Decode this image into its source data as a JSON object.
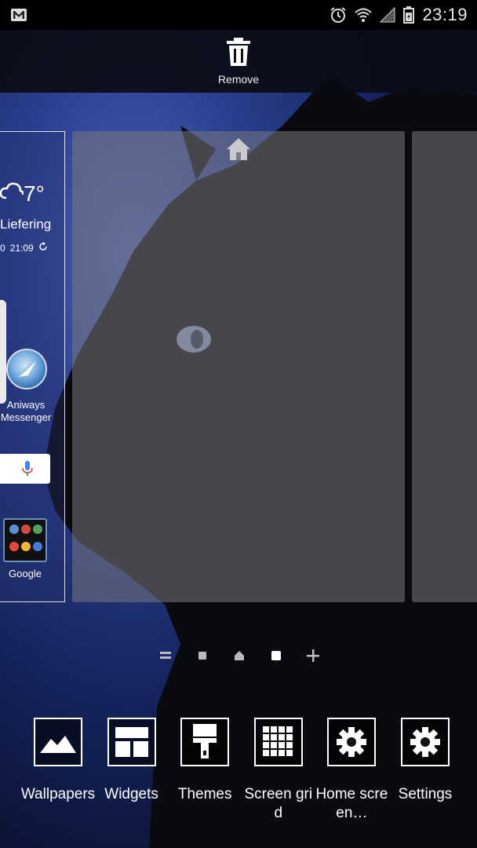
{
  "status_bar": {
    "time": "23:19",
    "left_icons": [
      "gmail-icon"
    ],
    "right_icons": [
      "alarm-icon",
      "wifi-icon",
      "signal-icon",
      "battery-icon"
    ]
  },
  "remove": {
    "label": "Remove",
    "icon": "trash-icon"
  },
  "left_page": {
    "weather": {
      "temp": "7°",
      "city": "Liefering",
      "date_fragment": "0",
      "time": "21:09"
    },
    "app": {
      "label_line1": "Aniways",
      "label_line2": "Messenger"
    },
    "folder": {
      "label": "Google"
    }
  },
  "center_page": {
    "home_icon": "home-icon"
  },
  "page_indicator": [
    "lines-icon",
    "square-dot",
    "home-dot",
    "square-dot-active",
    "plus-icon"
  ],
  "options": [
    {
      "id": "wallpapers",
      "label": "Wallpapers",
      "icon": "image-icon"
    },
    {
      "id": "widgets",
      "label": "Widgets",
      "icon": "widgets-icon"
    },
    {
      "id": "themes",
      "label": "Themes",
      "icon": "paint-brush-icon"
    },
    {
      "id": "screen-grid",
      "label": "Screen grid",
      "icon": "grid-icon"
    },
    {
      "id": "home-screen",
      "label": "Home screen…",
      "icon": "gear-icon"
    },
    {
      "id": "settings",
      "label": "Settings",
      "icon": "gear-icon"
    }
  ],
  "colors": {
    "status_bar": "#000000",
    "accent": "#ffffff",
    "page_overlay": "#78787d"
  }
}
